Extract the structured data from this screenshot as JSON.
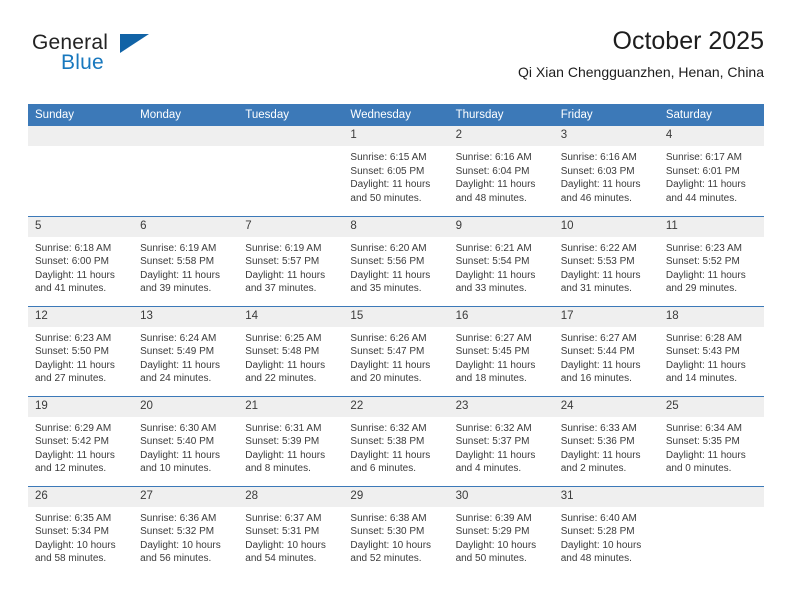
{
  "brand": {
    "line1": "General",
    "line2": "Blue",
    "triangle_icon": "brand-triangle-icon",
    "accent_dark": "#1163a6",
    "accent_blue": "#1878be"
  },
  "header": {
    "title": "October 2025",
    "subtitle": "Qi Xian Chengguanzhen, Henan, China"
  },
  "colors": {
    "header_blue": "#3c79b8",
    "daynum_band": "#efefef",
    "text": "#3b3b3b"
  },
  "calendar": {
    "weekday_headers": [
      "Sunday",
      "Monday",
      "Tuesday",
      "Wednesday",
      "Thursday",
      "Friday",
      "Saturday"
    ],
    "weeks": [
      [
        {
          "day": "",
          "lines": []
        },
        {
          "day": "",
          "lines": []
        },
        {
          "day": "",
          "lines": []
        },
        {
          "day": "1",
          "lines": [
            "Sunrise: 6:15 AM",
            "Sunset: 6:05 PM",
            "Daylight: 11 hours",
            "and 50 minutes."
          ]
        },
        {
          "day": "2",
          "lines": [
            "Sunrise: 6:16 AM",
            "Sunset: 6:04 PM",
            "Daylight: 11 hours",
            "and 48 minutes."
          ]
        },
        {
          "day": "3",
          "lines": [
            "Sunrise: 6:16 AM",
            "Sunset: 6:03 PM",
            "Daylight: 11 hours",
            "and 46 minutes."
          ]
        },
        {
          "day": "4",
          "lines": [
            "Sunrise: 6:17 AM",
            "Sunset: 6:01 PM",
            "Daylight: 11 hours",
            "and 44 minutes."
          ]
        }
      ],
      [
        {
          "day": "5",
          "lines": [
            "Sunrise: 6:18 AM",
            "Sunset: 6:00 PM",
            "Daylight: 11 hours",
            "and 41 minutes."
          ]
        },
        {
          "day": "6",
          "lines": [
            "Sunrise: 6:19 AM",
            "Sunset: 5:58 PM",
            "Daylight: 11 hours",
            "and 39 minutes."
          ]
        },
        {
          "day": "7",
          "lines": [
            "Sunrise: 6:19 AM",
            "Sunset: 5:57 PM",
            "Daylight: 11 hours",
            "and 37 minutes."
          ]
        },
        {
          "day": "8",
          "lines": [
            "Sunrise: 6:20 AM",
            "Sunset: 5:56 PM",
            "Daylight: 11 hours",
            "and 35 minutes."
          ]
        },
        {
          "day": "9",
          "lines": [
            "Sunrise: 6:21 AM",
            "Sunset: 5:54 PM",
            "Daylight: 11 hours",
            "and 33 minutes."
          ]
        },
        {
          "day": "10",
          "lines": [
            "Sunrise: 6:22 AM",
            "Sunset: 5:53 PM",
            "Daylight: 11 hours",
            "and 31 minutes."
          ]
        },
        {
          "day": "11",
          "lines": [
            "Sunrise: 6:23 AM",
            "Sunset: 5:52 PM",
            "Daylight: 11 hours",
            "and 29 minutes."
          ]
        }
      ],
      [
        {
          "day": "12",
          "lines": [
            "Sunrise: 6:23 AM",
            "Sunset: 5:50 PM",
            "Daylight: 11 hours",
            "and 27 minutes."
          ]
        },
        {
          "day": "13",
          "lines": [
            "Sunrise: 6:24 AM",
            "Sunset: 5:49 PM",
            "Daylight: 11 hours",
            "and 24 minutes."
          ]
        },
        {
          "day": "14",
          "lines": [
            "Sunrise: 6:25 AM",
            "Sunset: 5:48 PM",
            "Daylight: 11 hours",
            "and 22 minutes."
          ]
        },
        {
          "day": "15",
          "lines": [
            "Sunrise: 6:26 AM",
            "Sunset: 5:47 PM",
            "Daylight: 11 hours",
            "and 20 minutes."
          ]
        },
        {
          "day": "16",
          "lines": [
            "Sunrise: 6:27 AM",
            "Sunset: 5:45 PM",
            "Daylight: 11 hours",
            "and 18 minutes."
          ]
        },
        {
          "day": "17",
          "lines": [
            "Sunrise: 6:27 AM",
            "Sunset: 5:44 PM",
            "Daylight: 11 hours",
            "and 16 minutes."
          ]
        },
        {
          "day": "18",
          "lines": [
            "Sunrise: 6:28 AM",
            "Sunset: 5:43 PM",
            "Daylight: 11 hours",
            "and 14 minutes."
          ]
        }
      ],
      [
        {
          "day": "19",
          "lines": [
            "Sunrise: 6:29 AM",
            "Sunset: 5:42 PM",
            "Daylight: 11 hours",
            "and 12 minutes."
          ]
        },
        {
          "day": "20",
          "lines": [
            "Sunrise: 6:30 AM",
            "Sunset: 5:40 PM",
            "Daylight: 11 hours",
            "and 10 minutes."
          ]
        },
        {
          "day": "21",
          "lines": [
            "Sunrise: 6:31 AM",
            "Sunset: 5:39 PM",
            "Daylight: 11 hours",
            "and 8 minutes."
          ]
        },
        {
          "day": "22",
          "lines": [
            "Sunrise: 6:32 AM",
            "Sunset: 5:38 PM",
            "Daylight: 11 hours",
            "and 6 minutes."
          ]
        },
        {
          "day": "23",
          "lines": [
            "Sunrise: 6:32 AM",
            "Sunset: 5:37 PM",
            "Daylight: 11 hours",
            "and 4 minutes."
          ]
        },
        {
          "day": "24",
          "lines": [
            "Sunrise: 6:33 AM",
            "Sunset: 5:36 PM",
            "Daylight: 11 hours",
            "and 2 minutes."
          ]
        },
        {
          "day": "25",
          "lines": [
            "Sunrise: 6:34 AM",
            "Sunset: 5:35 PM",
            "Daylight: 11 hours",
            "and 0 minutes."
          ]
        }
      ],
      [
        {
          "day": "26",
          "lines": [
            "Sunrise: 6:35 AM",
            "Sunset: 5:34 PM",
            "Daylight: 10 hours",
            "and 58 minutes."
          ]
        },
        {
          "day": "27",
          "lines": [
            "Sunrise: 6:36 AM",
            "Sunset: 5:32 PM",
            "Daylight: 10 hours",
            "and 56 minutes."
          ]
        },
        {
          "day": "28",
          "lines": [
            "Sunrise: 6:37 AM",
            "Sunset: 5:31 PM",
            "Daylight: 10 hours",
            "and 54 minutes."
          ]
        },
        {
          "day": "29",
          "lines": [
            "Sunrise: 6:38 AM",
            "Sunset: 5:30 PM",
            "Daylight: 10 hours",
            "and 52 minutes."
          ]
        },
        {
          "day": "30",
          "lines": [
            "Sunrise: 6:39 AM",
            "Sunset: 5:29 PM",
            "Daylight: 10 hours",
            "and 50 minutes."
          ]
        },
        {
          "day": "31",
          "lines": [
            "Sunrise: 6:40 AM",
            "Sunset: 5:28 PM",
            "Daylight: 10 hours",
            "and 48 minutes."
          ]
        },
        {
          "day": "",
          "lines": []
        }
      ]
    ]
  }
}
